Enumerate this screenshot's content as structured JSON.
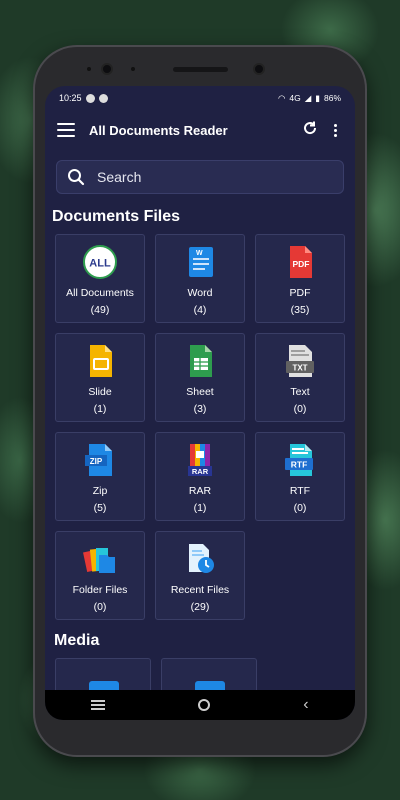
{
  "status": {
    "time": "10:25",
    "network": "4G",
    "battery": "86%"
  },
  "toolbar": {
    "title": "All Documents Reader"
  },
  "search": {
    "placeholder": "Search"
  },
  "documents": {
    "title": "Documents Files",
    "items": [
      {
        "label": "All Documents",
        "count": "(49)",
        "icon": "all-documents-icon"
      },
      {
        "label": "Word",
        "count": "(4)",
        "icon": "word-icon"
      },
      {
        "label": "PDF",
        "count": "(35)",
        "icon": "pdf-icon"
      },
      {
        "label": "Slide",
        "count": "(1)",
        "icon": "slide-icon"
      },
      {
        "label": "Sheet",
        "count": "(3)",
        "icon": "sheet-icon"
      },
      {
        "label": "Text",
        "count": "(0)",
        "icon": "text-icon"
      },
      {
        "label": "Zip",
        "count": "(5)",
        "icon": "zip-icon"
      },
      {
        "label": "RAR",
        "count": "(1)",
        "icon": "rar-icon"
      },
      {
        "label": "RTF",
        "count": "(0)",
        "icon": "rtf-icon"
      },
      {
        "label": "Folder Files",
        "count": "(0)",
        "icon": "folder-files-icon"
      },
      {
        "label": "Recent Files",
        "count": "(29)",
        "icon": "recent-files-icon"
      }
    ]
  },
  "icon_text": {
    "all": "ALL",
    "pdf": "PDF",
    "txt": "TXT",
    "zip": "ZIP",
    "rar": "RAR",
    "rtf": "RTF",
    "word": "W"
  },
  "media": {
    "title": "Media"
  },
  "colors": {
    "background": "#1f2143",
    "tile": "#25284c",
    "accent_blue": "#1e88e5",
    "pdf_red": "#e53935",
    "sheet_green": "#2e9d4e",
    "slide_yellow": "#f5b400"
  }
}
